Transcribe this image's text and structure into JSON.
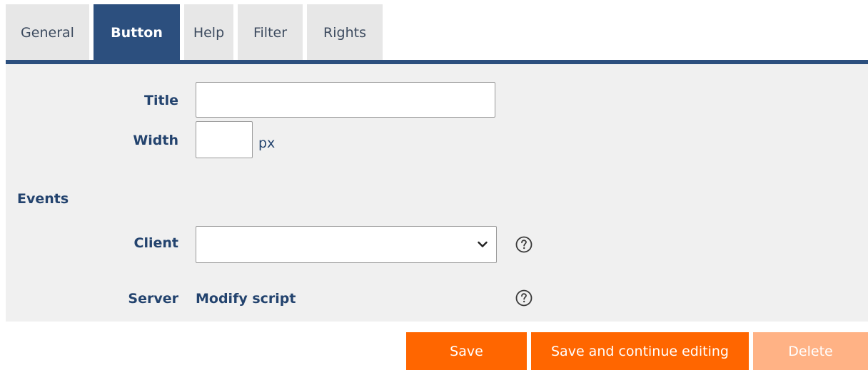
{
  "tabs": [
    {
      "label": "General",
      "active": false
    },
    {
      "label": "Button",
      "active": true
    },
    {
      "label": "Help",
      "active": false
    },
    {
      "label": "Filter",
      "active": false
    },
    {
      "label": "Rights",
      "active": false
    }
  ],
  "form": {
    "title_label": "Title",
    "title_value": "",
    "width_label": "Width",
    "width_value": "",
    "width_unit": "px",
    "events_heading": "Events",
    "client_label": "Client",
    "client_selected": "",
    "server_label": "Server",
    "server_link": "Modify script"
  },
  "actions": {
    "save": "Save",
    "save_continue": "Save and continue editing",
    "delete": "Delete"
  },
  "icons": {
    "help": "help-circle-icon",
    "dropdown": "chevron-down-icon"
  },
  "colors": {
    "accent_blue": "#2c4f7e",
    "label_blue": "#23436e",
    "orange": "#ff6600",
    "orange_disabled": "#ffb285",
    "panel_bg": "#f0f0f0"
  }
}
